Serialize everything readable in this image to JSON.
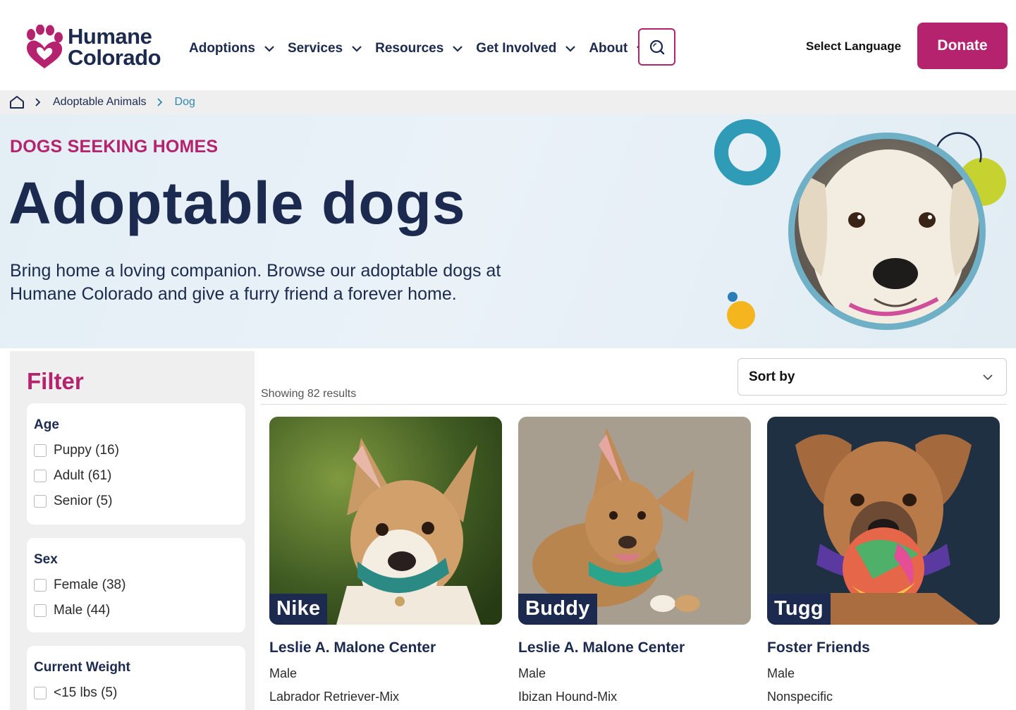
{
  "header": {
    "logo_line1": "Humane",
    "logo_line2": "Colorado",
    "nav": [
      {
        "label": "Adoptions"
      },
      {
        "label": "Services"
      },
      {
        "label": "Resources"
      },
      {
        "label": "Get Involved"
      },
      {
        "label": "About"
      }
    ],
    "select_language": "Select Language",
    "donate_label": "Donate"
  },
  "breadcrumb": {
    "items": [
      "Adoptable Animals",
      "Dog"
    ]
  },
  "hero": {
    "eyebrow": "DOGS SEEKING HOMES",
    "title": "Adoptable dogs",
    "description": "Bring home a loving companion. Browse our adoptable dogs at Humane Colorado and give a furry friend a forever home."
  },
  "filter": {
    "title": "Filter",
    "groups": [
      {
        "title": "Age",
        "options": [
          "Puppy (16)",
          "Adult (61)",
          "Senior (5)"
        ]
      },
      {
        "title": "Sex",
        "options": [
          "Female (38)",
          "Male (44)"
        ]
      },
      {
        "title": "Current Weight",
        "options": [
          "<15 lbs (5)"
        ]
      }
    ]
  },
  "results": {
    "count_text": "Showing 82 results",
    "sort_label": "Sort by",
    "cards": [
      {
        "name": "Nike",
        "location": "Leslie A. Malone Center",
        "sex": "Male",
        "breed": "Labrador Retriever-Mix"
      },
      {
        "name": "Buddy",
        "location": "Leslie A. Malone Center",
        "sex": "Male",
        "breed": "Ibizan Hound-Mix"
      },
      {
        "name": "Tugg",
        "location": "Foster Friends",
        "sex": "Male",
        "breed": "Nonspecific"
      }
    ]
  },
  "colors": {
    "brand_magenta": "#b5226e",
    "navy": "#1b2a4e",
    "teal": "#2f9bb7",
    "lime": "#c5d22f",
    "yellow": "#f5b51e"
  }
}
